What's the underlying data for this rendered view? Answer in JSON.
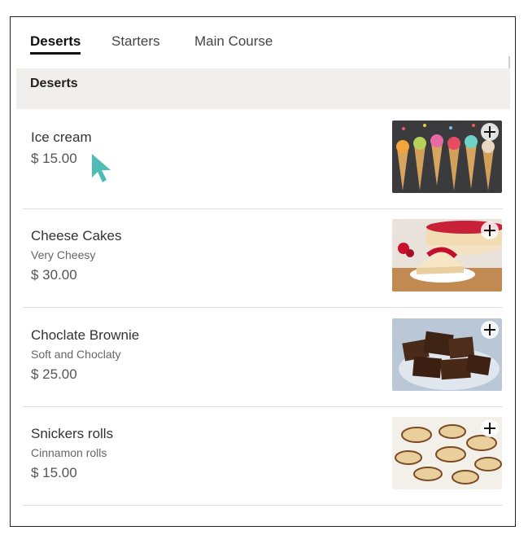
{
  "tabs": [
    {
      "label": "Deserts",
      "active": true
    },
    {
      "label": "Starters",
      "active": false
    },
    {
      "label": "Main Course",
      "active": false
    }
  ],
  "section": {
    "title": "Deserts"
  },
  "items": [
    {
      "name": "Ice cream",
      "description": "",
      "price": "$ 15.00",
      "image": "ice-cream-cones"
    },
    {
      "name": "Cheese Cakes",
      "description": "Very Cheesy",
      "price": "$ 30.00",
      "image": "cheesecake-slice"
    },
    {
      "name": "Choclate Brownie",
      "description": "Soft and Choclaty",
      "price": "$ 25.00",
      "image": "brownie-pieces"
    },
    {
      "name": "Snickers rolls",
      "description": "Cinnamon rolls",
      "price": "$ 15.00",
      "image": "snickers-rolls"
    }
  ],
  "icons": {
    "add": "plus-icon",
    "cursor": "mouse-pointer-icon"
  },
  "colors": {
    "cursor": "#4dbdb5",
    "section_bg": "#f0efed",
    "active_tab": "#111111"
  }
}
